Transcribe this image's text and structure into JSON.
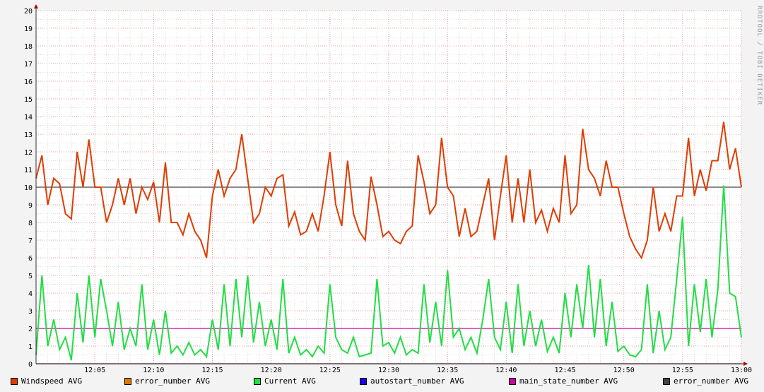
{
  "chart_data": {
    "type": "line",
    "title": "",
    "watermark": "RRDTOOL / TOBI OETIKER",
    "xlabel": "",
    "ylabel": "",
    "ylim": [
      0,
      20
    ],
    "yticks": [
      "0",
      "1",
      "2",
      "3",
      "4",
      "5",
      "6",
      "7",
      "8",
      "9",
      "10",
      "11",
      "12",
      "13",
      "14",
      "15",
      "16",
      "17",
      "18",
      "19",
      "20"
    ],
    "xlim_minutes": [
      0,
      60
    ],
    "xticks": [
      {
        "t": 5,
        "label": "12:05"
      },
      {
        "t": 10,
        "label": "12:10"
      },
      {
        "t": 15,
        "label": "12:15"
      },
      {
        "t": 20,
        "label": "12:20"
      },
      {
        "t": 25,
        "label": "12:25"
      },
      {
        "t": 30,
        "label": "12:30"
      },
      {
        "t": 35,
        "label": "12:35"
      },
      {
        "t": 40,
        "label": "12:40"
      },
      {
        "t": 45,
        "label": "12:45"
      },
      {
        "t": 50,
        "label": "12:50"
      },
      {
        "t": 55,
        "label": "12:55"
      },
      {
        "t": 60,
        "label": "13:00"
      }
    ],
    "sample_step_minutes": 0.5,
    "grid": true,
    "legend_position": "bottom",
    "series": [
      {
        "name": "Windspeed AVG",
        "color": "#e03c00",
        "values": [
          10.5,
          11.8,
          9,
          10.5,
          10.2,
          8.5,
          8.2,
          12,
          10,
          12.7,
          10,
          10,
          8,
          9,
          10.5,
          9,
          10.5,
          8.5,
          10,
          9.3,
          10.3,
          8,
          11.4,
          8,
          8,
          7.3,
          8.5,
          7.5,
          7,
          6,
          9.5,
          11,
          9.5,
          10.5,
          11,
          13,
          10.5,
          8,
          8.5,
          10,
          9.5,
          10.5,
          10.7,
          7.8,
          8.6,
          7.3,
          7.5,
          8.5,
          7.5,
          9.5,
          12,
          9,
          7.8,
          11.5,
          8.5,
          7.5,
          7,
          10.6,
          9,
          7.2,
          7.5,
          7,
          6.8,
          7.5,
          7.8,
          11.8,
          10.3,
          8.5,
          9,
          12.8,
          10,
          9.5,
          7.2,
          8.8,
          7.2,
          7.5,
          9,
          10.5,
          7,
          9.5,
          11.8,
          8,
          10.5,
          8,
          11,
          8,
          8.7,
          7.5,
          8.8,
          8,
          11.8,
          8.5,
          9,
          13.3,
          11,
          10.5,
          9.5,
          11.5,
          10,
          10,
          8.5,
          7.2,
          6.5,
          6,
          7,
          10,
          7.5,
          8.5,
          7.5,
          9.5,
          9.5,
          12.8,
          9.5,
          11,
          9.8,
          11.5,
          11.5,
          13.7,
          11,
          12.2,
          10
        ]
      },
      {
        "name": "error_number AVG",
        "color": "#e07800",
        "values": [
          0,
          0
        ]
      },
      {
        "name": "Current AVG",
        "color": "#22dd44",
        "values": [
          0.5,
          5,
          1,
          2.5,
          0.8,
          1.5,
          0.2,
          4,
          1.2,
          5,
          1.5,
          4.8,
          3,
          1,
          3.5,
          0.8,
          2,
          1,
          4.5,
          0.8,
          2.5,
          0.5,
          3,
          0.6,
          1,
          0.5,
          1.2,
          0.5,
          0.8,
          0.4,
          2.5,
          0.8,
          4.5,
          1,
          4.8,
          1.5,
          5,
          1.2,
          3.5,
          1,
          2.5,
          0.8,
          4.8,
          0.6,
          1.5,
          0.5,
          0.8,
          0.4,
          1,
          0.6,
          4.5,
          1.5,
          0.8,
          0.6,
          1.5,
          0.4,
          0.5,
          0.6,
          4.8,
          1,
          1.2,
          0.6,
          1.5,
          0.5,
          0.8,
          0.6,
          4.5,
          1.2,
          3.5,
          1,
          5.3,
          1.5,
          2,
          0.8,
          1.5,
          0.6,
          2.5,
          4.8,
          1.5,
          0.8,
          3.5,
          0.6,
          4.5,
          1,
          3,
          1,
          2.5,
          0.7,
          1.5,
          0.6,
          4,
          1.5,
          4.5,
          2,
          5.6,
          1.5,
          4.8,
          1,
          3.5,
          0.7,
          1,
          0.5,
          0.4,
          0.8,
          4.5,
          0.6,
          3,
          0.8,
          1.5,
          4.8,
          8.3,
          1,
          4.5,
          1.8,
          4.8,
          1.5,
          4.2,
          10.1,
          4,
          3.8,
          1.5
        ]
      },
      {
        "name": "autostart_number AVG",
        "color": "#2200e0",
        "values": [
          0,
          0
        ]
      },
      {
        "name": "main_state_number AVG",
        "color": "#d000a0",
        "values": [
          2,
          2
        ]
      },
      {
        "name": "error_number AVG",
        "color": "#444444",
        "values": [
          10,
          10
        ]
      }
    ]
  }
}
